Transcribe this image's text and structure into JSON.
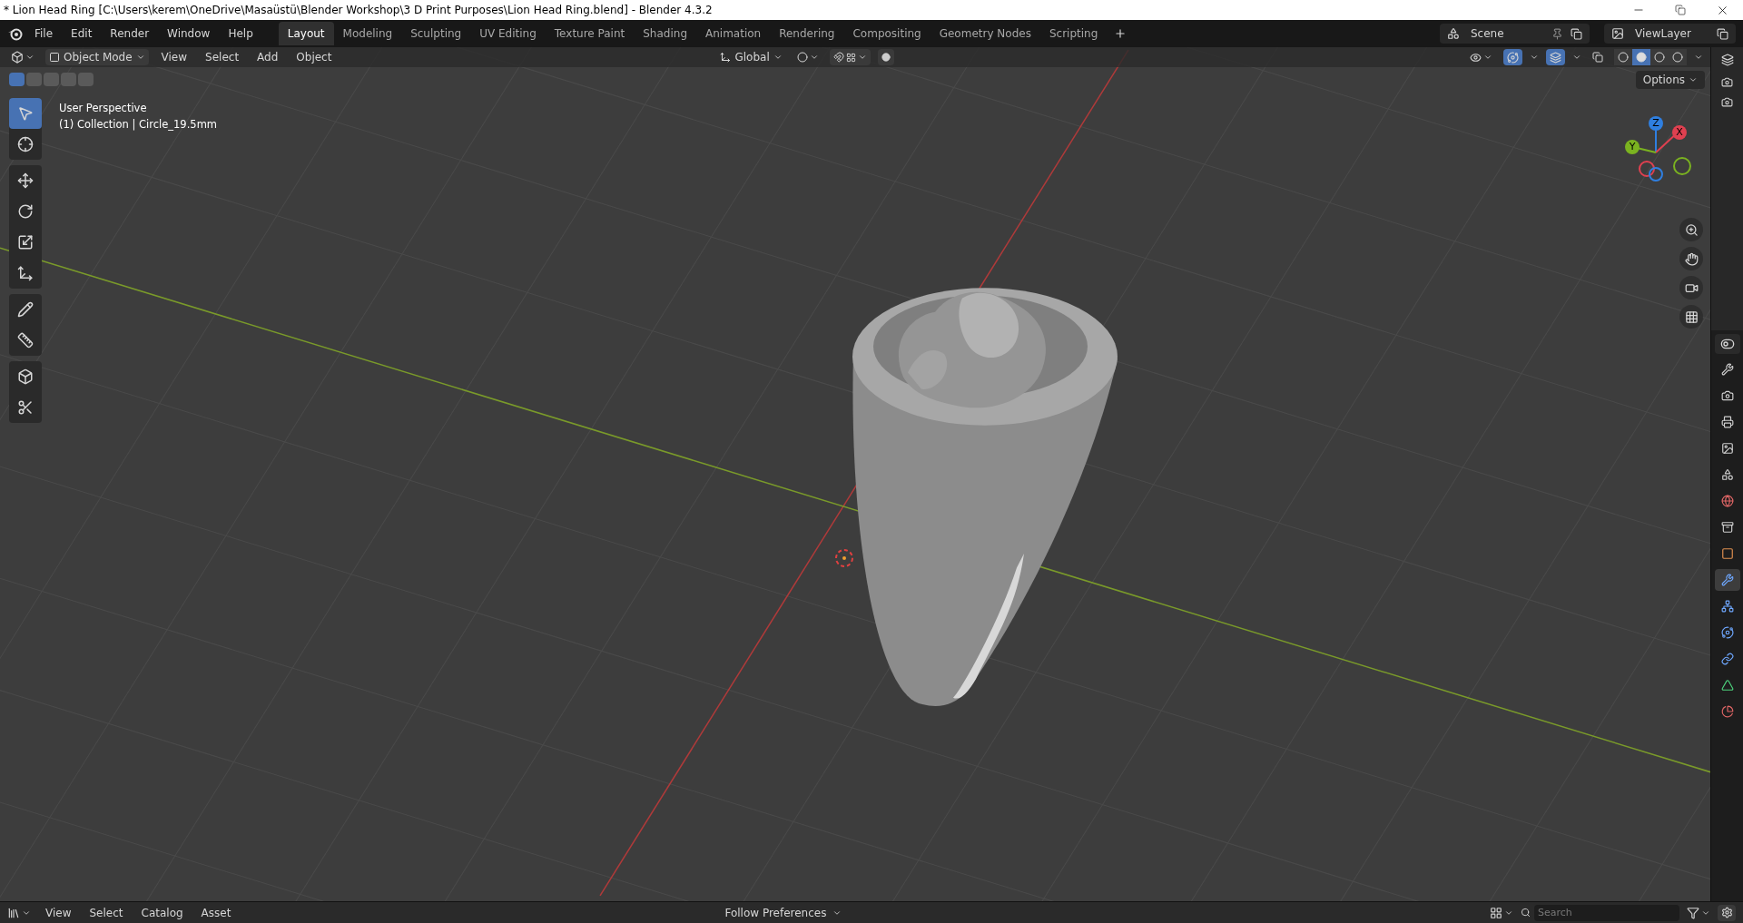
{
  "window": {
    "title": "* Lion Head Ring [C:\\Users\\kerem\\OneDrive\\Masaüstü\\Blender Workshop\\3 D Print Purposes\\Lion Head Ring.blend] - Blender 4.3.2"
  },
  "menu": [
    "File",
    "Edit",
    "Render",
    "Window",
    "Help"
  ],
  "workspaces": [
    {
      "label": "Layout",
      "selected": true
    },
    {
      "label": "Modeling",
      "selected": false
    },
    {
      "label": "Sculpting",
      "selected": false
    },
    {
      "label": "UV Editing",
      "selected": false
    },
    {
      "label": "Texture Paint",
      "selected": false
    },
    {
      "label": "Shading",
      "selected": false
    },
    {
      "label": "Animation",
      "selected": false
    },
    {
      "label": "Rendering",
      "selected": false
    },
    {
      "label": "Compositing",
      "selected": false
    },
    {
      "label": "Geometry Nodes",
      "selected": false
    },
    {
      "label": "Scripting",
      "selected": false
    }
  ],
  "scene": "Scene",
  "view_layer": "ViewLayer",
  "header": {
    "mode": "Object Mode",
    "menus": [
      "View",
      "Select",
      "Add",
      "Object"
    ],
    "orientation": "Global",
    "options": "Options"
  },
  "select_modes": [
    {
      "selected": true
    },
    {
      "selected": false
    },
    {
      "selected": false
    },
    {
      "selected": false
    },
    {
      "selected": false
    }
  ],
  "overlays": {
    "gizmos_on": true,
    "overlays_on": true
  },
  "shading": [
    {
      "kind": "wireframe",
      "selected": false
    },
    {
      "kind": "solid",
      "selected": true
    },
    {
      "kind": "material",
      "selected": false
    },
    {
      "kind": "rendered",
      "selected": false
    }
  ],
  "viewport": {
    "view_name": "User Perspective",
    "collection": "(1) Collection | Circle_19.5mm"
  },
  "tool_groups": [
    {
      "tools": [
        {
          "kind": "select",
          "selected": true
        },
        {
          "kind": "cursor",
          "selected": false
        }
      ]
    },
    {
      "tools": [
        {
          "kind": "move",
          "selected": false
        },
        {
          "kind": "rotate",
          "selected": false
        },
        {
          "kind": "scale",
          "selected": false
        },
        {
          "kind": "transform",
          "selected": false
        }
      ]
    },
    {
      "tools": [
        {
          "kind": "annotate",
          "selected": false
        },
        {
          "kind": "measure",
          "selected": false
        }
      ]
    },
    {
      "tools": [
        {
          "kind": "add_cube",
          "selected": false
        },
        {
          "kind": "cut",
          "selected": false
        }
      ]
    }
  ],
  "gizmo": {
    "x": "X",
    "y": "Y",
    "z": "Z"
  },
  "properties_tabs": [
    {
      "kind": "tool",
      "selected": false
    },
    {
      "kind": "render",
      "selected": false
    },
    {
      "kind": "output",
      "selected": false
    },
    {
      "kind": "view_layer",
      "selected": false
    },
    {
      "kind": "scene",
      "selected": false
    },
    {
      "kind": "world",
      "selected": false
    },
    {
      "kind": "collection",
      "selected": false
    },
    {
      "kind": "object",
      "selected": false
    },
    {
      "kind": "modifiers",
      "selected": true
    },
    {
      "kind": "particles",
      "selected": false
    },
    {
      "kind": "physics",
      "selected": false
    },
    {
      "kind": "constraints",
      "selected": false
    },
    {
      "kind": "data",
      "selected": false
    },
    {
      "kind": "material",
      "selected": false
    }
  ],
  "footer": {
    "menus": [
      "View",
      "Select",
      "Catalog",
      "Asset"
    ],
    "preferences": "Follow Preferences",
    "search": {
      "placeholder": "Search"
    }
  }
}
